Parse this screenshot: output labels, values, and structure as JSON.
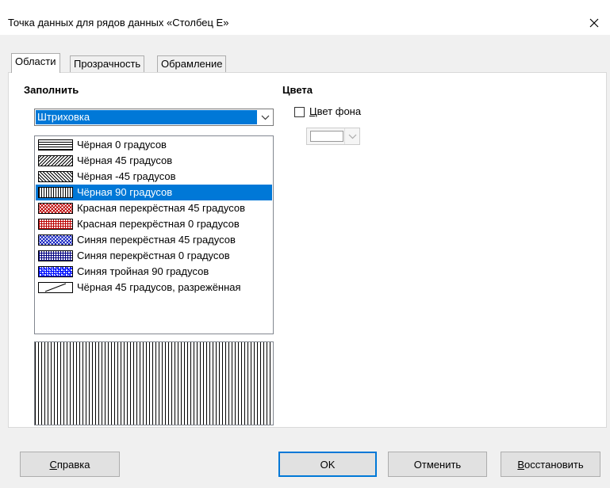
{
  "window": {
    "title": "Точка данных для рядов данных «Столбец E»"
  },
  "tabs": [
    {
      "label": "Области",
      "active": true
    },
    {
      "label": "Прозрачность",
      "active": false
    },
    {
      "label": "Обрамление",
      "active": false
    }
  ],
  "fill": {
    "section_label": "Заполнить",
    "type_selected": "Штриховка",
    "hatch_list": [
      {
        "label": "Чёрная 0 градусов",
        "pattern": "black-0",
        "selected": false
      },
      {
        "label": "Чёрная 45 градусов",
        "pattern": "black-45",
        "selected": false
      },
      {
        "label": "Чёрная -45 градусов",
        "pattern": "black-minus-45",
        "selected": false
      },
      {
        "label": "Чёрная 90 градусов",
        "pattern": "black-90",
        "selected": true
      },
      {
        "label": "Красная перекрёстная 45 градусов",
        "pattern": "red-cross-45",
        "selected": false
      },
      {
        "label": "Красная перекрёстная 0 градусов",
        "pattern": "red-cross-0",
        "selected": false
      },
      {
        "label": "Синяя перекрёстная 45 градусов",
        "pattern": "blue-cross-45",
        "selected": false
      },
      {
        "label": "Синяя перекрёстная 0 градусов",
        "pattern": "blue-cross-0",
        "selected": false
      },
      {
        "label": "Синяя тройная 90 градусов",
        "pattern": "blue-triple-90",
        "selected": false
      },
      {
        "label": "Чёрная 45 градусов, разрежённая",
        "pattern": "black-45-sparse",
        "selected": false
      }
    ]
  },
  "colors": {
    "section_label": "Цвета",
    "background_color_checkbox": {
      "label_accel": "Ц",
      "label_rest": "вет фона",
      "checked": false
    },
    "background_color_value": "#ffffff"
  },
  "buttons": {
    "help": {
      "accel": "С",
      "rest": "правка"
    },
    "ok": "OK",
    "cancel": "Отменить",
    "reset": {
      "accel": "В",
      "rest": "осстановить"
    }
  },
  "theme": {
    "selection": "#0078d7",
    "panel": "#ffffff",
    "dialog_bg": "#f0f0f0"
  }
}
